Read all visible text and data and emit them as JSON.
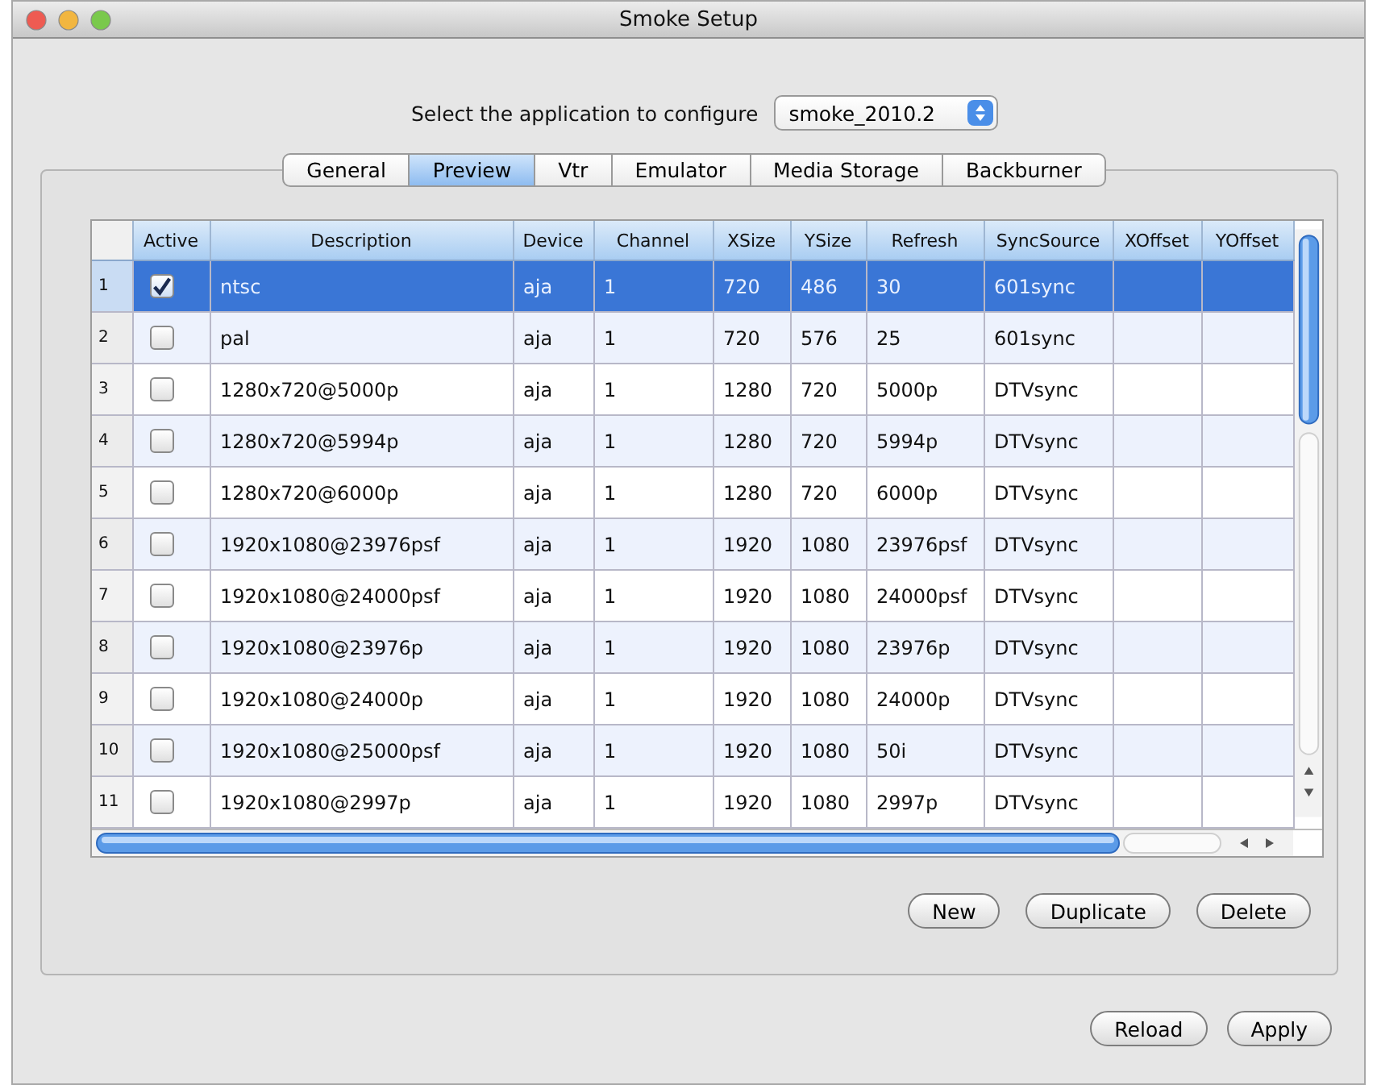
{
  "window": {
    "title": "Smoke Setup"
  },
  "app_selector": {
    "label": "Select the application to configure",
    "value": "smoke_2010.2"
  },
  "tabs": [
    {
      "label": "General",
      "selected": false
    },
    {
      "label": "Preview",
      "selected": true
    },
    {
      "label": "Vtr",
      "selected": false
    },
    {
      "label": "Emulator",
      "selected": false
    },
    {
      "label": "Media Storage",
      "selected": false
    },
    {
      "label": "Backburner",
      "selected": false
    }
  ],
  "table": {
    "columns": [
      "",
      "Active",
      "Description",
      "Device",
      "Channel",
      "XSize",
      "YSize",
      "Refresh",
      "SyncSource",
      "XOffset",
      "YOffset"
    ],
    "rows": [
      {
        "active": true,
        "selected": true,
        "cells": [
          "1",
          "",
          "ntsc",
          "aja",
          "1",
          "720",
          "486",
          "30",
          "601sync",
          "",
          ""
        ]
      },
      {
        "active": false,
        "selected": false,
        "cells": [
          "2",
          "",
          "pal",
          "aja",
          "1",
          "720",
          "576",
          "25",
          "601sync",
          "",
          ""
        ]
      },
      {
        "active": false,
        "selected": false,
        "cells": [
          "3",
          "",
          "1280x720@5000p",
          "aja",
          "1",
          "1280",
          "720",
          "5000p",
          "DTVsync",
          "",
          ""
        ]
      },
      {
        "active": false,
        "selected": false,
        "cells": [
          "4",
          "",
          "1280x720@5994p",
          "aja",
          "1",
          "1280",
          "720",
          "5994p",
          "DTVsync",
          "",
          ""
        ]
      },
      {
        "active": false,
        "selected": false,
        "cells": [
          "5",
          "",
          "1280x720@6000p",
          "aja",
          "1",
          "1280",
          "720",
          "6000p",
          "DTVsync",
          "",
          ""
        ]
      },
      {
        "active": false,
        "selected": false,
        "cells": [
          "6",
          "",
          "1920x1080@23976psf",
          "aja",
          "1",
          "1920",
          "1080",
          "23976psf",
          "DTVsync",
          "",
          ""
        ]
      },
      {
        "active": false,
        "selected": false,
        "cells": [
          "7",
          "",
          "1920x1080@24000psf",
          "aja",
          "1",
          "1920",
          "1080",
          "24000psf",
          "DTVsync",
          "",
          ""
        ]
      },
      {
        "active": false,
        "selected": false,
        "cells": [
          "8",
          "",
          "1920x1080@23976p",
          "aja",
          "1",
          "1920",
          "1080",
          "23976p",
          "DTVsync",
          "",
          ""
        ]
      },
      {
        "active": false,
        "selected": false,
        "cells": [
          "9",
          "",
          "1920x1080@24000p",
          "aja",
          "1",
          "1920",
          "1080",
          "24000p",
          "DTVsync",
          "",
          ""
        ]
      },
      {
        "active": false,
        "selected": false,
        "cells": [
          "10",
          "",
          "1920x1080@25000psf",
          "aja",
          "1",
          "1920",
          "1080",
          "50i",
          "DTVsync",
          "",
          ""
        ]
      },
      {
        "active": false,
        "selected": false,
        "cells": [
          "11",
          "",
          "1920x1080@2997p",
          "aja",
          "1",
          "1920",
          "1080",
          "2997p",
          "DTVsync",
          "",
          ""
        ]
      }
    ]
  },
  "table_buttons": [
    "New",
    "Duplicate",
    "Delete"
  ],
  "footer_buttons": [
    "Reload",
    "Apply"
  ]
}
